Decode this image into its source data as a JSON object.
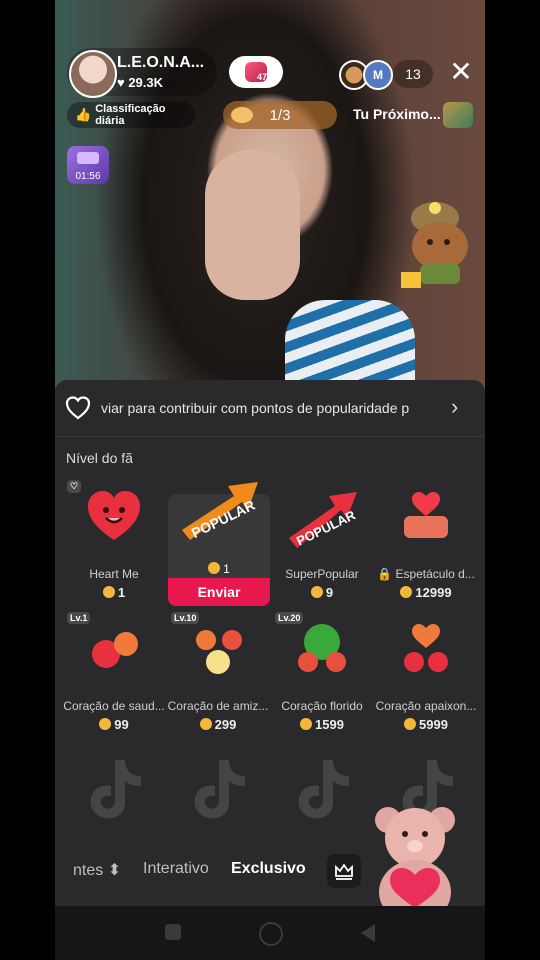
{
  "stream": {
    "host_name": "L.E.O.N.A...",
    "host_likes": "♥ 29.3K",
    "follow_badge": "47",
    "viewer_avatars": [
      "8",
      "M"
    ],
    "viewer_count": "13",
    "rank_label": "Classificação diária",
    "progress": "1/3",
    "next_label": "Tu Próximo...",
    "timer": "01:56"
  },
  "panel": {
    "contrib_text": "viar para contribuir com pontos de popularidade p",
    "fan_level_label": "Nível do fã",
    "gifts": [
      {
        "name": "Heart Me",
        "price": "1",
        "badge": ""
      },
      {
        "name": "",
        "price": "1",
        "badge": "",
        "selected_price": "1",
        "send_label": "Enviar"
      },
      {
        "name": "SuperPopular",
        "price": "9",
        "badge": ""
      },
      {
        "name": "Espetáculo d...",
        "price": "12999",
        "badge": ""
      },
      {
        "name": "Coração de saud...",
        "price": "99",
        "badge": "Lv.1"
      },
      {
        "name": "Coração de amiz...",
        "price": "299",
        "badge": "Lv.10"
      },
      {
        "name": "Coração florido",
        "price": "1599",
        "badge": "Lv.20"
      },
      {
        "name": "Coração apaixon...",
        "price": "5999",
        "badge": ""
      }
    ],
    "popular_text": "POPULAR",
    "superpopular_text": "POPULAR",
    "tabs": {
      "left": "ntes ⬍",
      "interativo": "Interativo",
      "exclusivo": "Exclusivo"
    }
  },
  "colors": {
    "accent": "#e8184f",
    "coin": "#f4b73a",
    "panel_bg": "#2a2a2c"
  },
  "icons": [
    "heart-icon",
    "close-icon",
    "thumbs-up-icon",
    "chevron-right-icon",
    "crown-icon",
    "coin-icon",
    "tiktok-logo-icon",
    "lock-icon"
  ]
}
